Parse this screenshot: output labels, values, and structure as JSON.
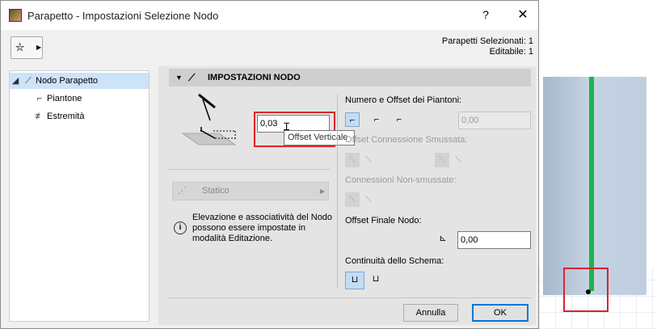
{
  "window": {
    "title": "Parapetto - Impostazioni Selezione Nodo",
    "help_label": "?",
    "close_label": "✕"
  },
  "selection_info": {
    "line1": "Parapetti Selezionati: 1",
    "line2": "Editabile: 1"
  },
  "tree": {
    "items": [
      {
        "label": "Nodo Parapetto",
        "icon": "railing-node-icon",
        "selected": true
      },
      {
        "label": "Piantone",
        "icon": "post-icon",
        "selected": false
      },
      {
        "label": "Estremità",
        "icon": "end-icon",
        "selected": false
      }
    ]
  },
  "section": {
    "title": "IMPOSTAZIONI NODO"
  },
  "vertical_offset": {
    "value": "0,03",
    "tooltip": "Offset Verticale"
  },
  "posts": {
    "label": "Numero e Offset dei Piantoni:",
    "value": "0,00"
  },
  "smooth_connection": {
    "label": "Offset Connessione Smussata:"
  },
  "non_smooth": {
    "label": "Connessioni Non-smussate:"
  },
  "final_offset": {
    "label": "Offset Finale Nodo:",
    "value": "0,00"
  },
  "continuity": {
    "label": "Continuità dello Schema:"
  },
  "static_dropdown": {
    "label": "Statico"
  },
  "info": {
    "icon_label": "i",
    "text": "Elevazione e associatività del Nodo possono essere impostate in modalità Editazione."
  },
  "buttons": {
    "cancel": "Annulla",
    "ok": "OK"
  },
  "colors": {
    "accent": "#0078d7",
    "highlight": "#e0252b",
    "post_green": "#21b24b"
  }
}
